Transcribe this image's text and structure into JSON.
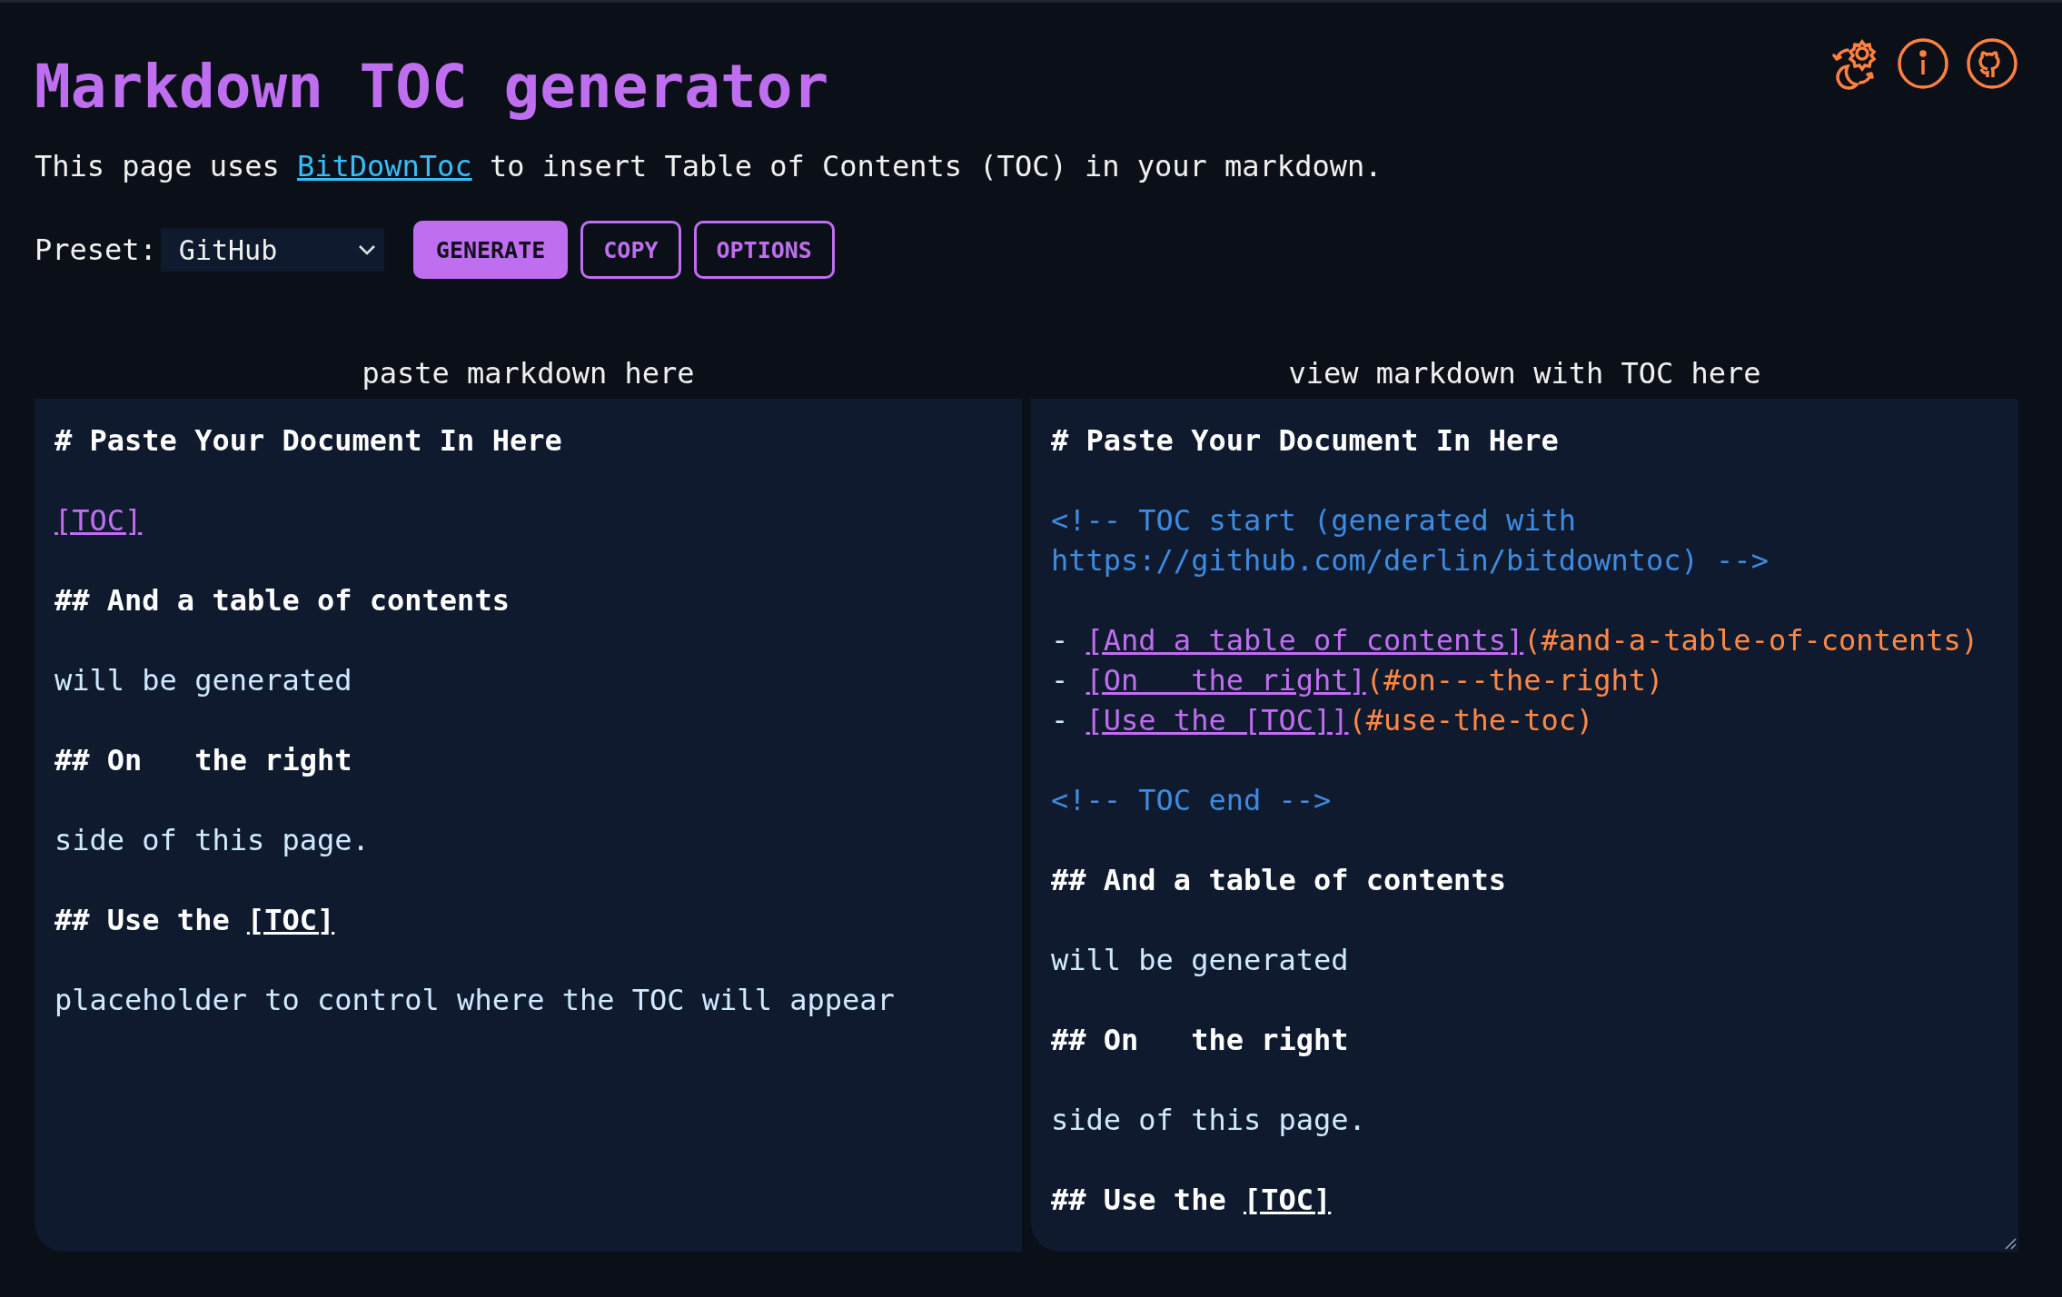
{
  "header": {
    "title": "Markdown TOC generator",
    "intro": {
      "before": "This page uses ",
      "link": "BitDownToc",
      "after": " to insert Table of Contents (TOC) in your markdown."
    }
  },
  "toolbar_icons": [
    {
      "kind": "theme"
    },
    {
      "kind": "info"
    },
    {
      "kind": "github"
    }
  ],
  "controls": {
    "preset_label": "Preset:",
    "preset_value": "GitHub",
    "buttons": [
      {
        "label": "GENERATE",
        "kind": "primary"
      },
      {
        "label": "COPY",
        "kind": "outline"
      },
      {
        "label": "OPTIONS",
        "kind": "outline"
      }
    ]
  },
  "panels": [
    {
      "label": "paste markdown here",
      "resizable": false,
      "blocks": [
        {
          "lines": [
            [
              {
                "kind": "heading",
                "text": "# Paste Your Document In Here"
              }
            ]
          ]
        },
        {
          "lines": [
            [
              {
                "kind": "link",
                "text": "[TOC]"
              }
            ]
          ]
        },
        {
          "lines": [
            [
              {
                "kind": "heading",
                "text": "## And a table of contents"
              }
            ]
          ]
        },
        {
          "lines": [
            [
              {
                "kind": "text",
                "text": "will be generated"
              }
            ]
          ]
        },
        {
          "lines": [
            [
              {
                "kind": "heading",
                "text": "## On   the right"
              }
            ]
          ]
        },
        {
          "lines": [
            [
              {
                "kind": "text",
                "text": "side of this page."
              }
            ]
          ]
        },
        {
          "lines": [
            [
              {
                "kind": "heading",
                "text": "## Use the "
              },
              {
                "kind": "heading_link",
                "text": "[TOC]"
              }
            ]
          ]
        },
        {
          "lines": [
            [
              {
                "kind": "text",
                "text": "placeholder to control where the TOC will appear"
              }
            ]
          ]
        }
      ]
    },
    {
      "label": "view markdown with TOC here",
      "resizable": true,
      "blocks": [
        {
          "lines": [
            [
              {
                "kind": "heading",
                "text": "# Paste Your Document In Here"
              }
            ]
          ]
        },
        {
          "lines": [
            [
              {
                "kind": "comment",
                "text": "<!-- TOC start (generated with"
              }
            ],
            [
              {
                "kind": "comment",
                "text": "https://github.com/derlin/bitdowntoc) -->"
              }
            ]
          ]
        },
        {
          "lines": [
            [
              {
                "kind": "bullet",
                "text": "- "
              },
              {
                "kind": "link",
                "text": "[And a table of contents]"
              },
              {
                "kind": "anchor",
                "text": "(#and-a-table-of-contents)"
              }
            ],
            [
              {
                "kind": "bullet",
                "text": "- "
              },
              {
                "kind": "link",
                "text": "[On   the right]"
              },
              {
                "kind": "anchor",
                "text": "(#on---the-right)"
              }
            ],
            [
              {
                "kind": "bullet",
                "text": "- "
              },
              {
                "kind": "link",
                "text": "[Use the [TOC]]"
              },
              {
                "kind": "anchor",
                "text": "(#use-the-toc)"
              }
            ]
          ]
        },
        {
          "lines": [
            [
              {
                "kind": "comment",
                "text": "<!-- TOC end -->"
              }
            ]
          ]
        },
        {
          "lines": [
            [
              {
                "kind": "heading",
                "text": "## And a table of contents"
              }
            ]
          ]
        },
        {
          "lines": [
            [
              {
                "kind": "text",
                "text": "will be generated"
              }
            ]
          ]
        },
        {
          "lines": [
            [
              {
                "kind": "heading",
                "text": "## On   the right"
              }
            ]
          ]
        },
        {
          "lines": [
            [
              {
                "kind": "text",
                "text": "side of this page."
              }
            ]
          ]
        },
        {
          "lines": [
            [
              {
                "kind": "heading",
                "text": "## Use the "
              },
              {
                "kind": "heading_link",
                "text": "[TOC]"
              }
            ]
          ]
        }
      ]
    }
  ]
}
